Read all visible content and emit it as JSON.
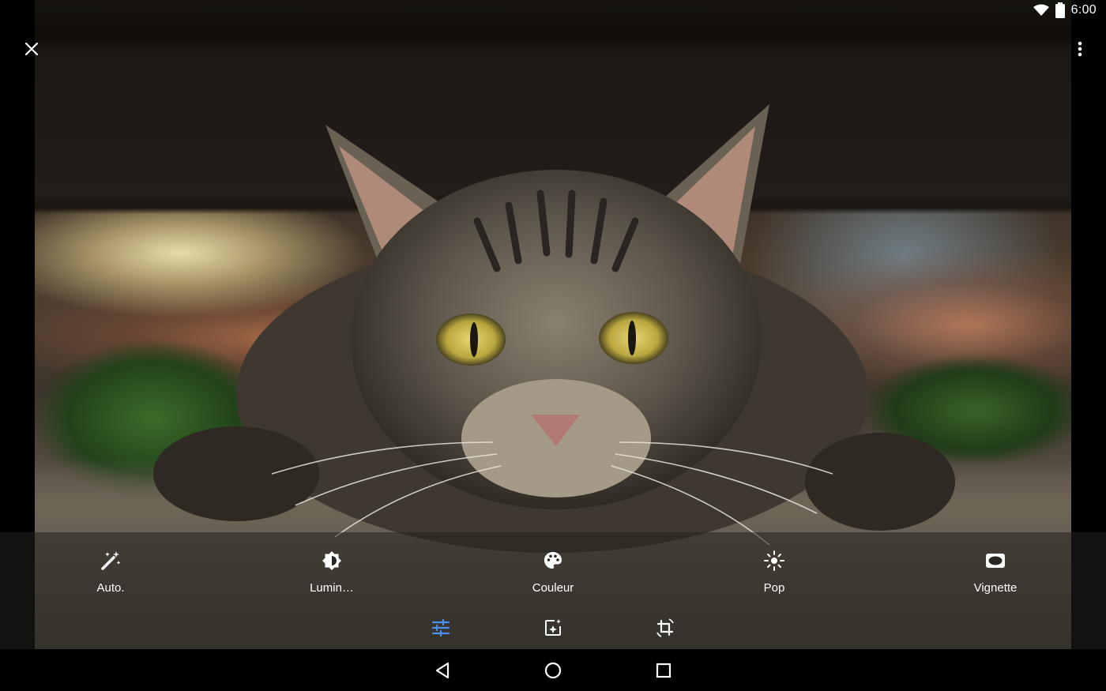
{
  "status_bar": {
    "time": "6:00",
    "icons": [
      "wifi-icon",
      "battery-icon"
    ]
  },
  "top_bar": {
    "close_icon": "close-icon",
    "menu_icon": "more-vert-icon"
  },
  "photo": {
    "subject": "tabby cat photo"
  },
  "edit_tools": [
    {
      "label": "Auto.",
      "icon": "magic-wand-icon"
    },
    {
      "label": "Lumin…",
      "icon": "brightness-icon"
    },
    {
      "label": "Couleur",
      "icon": "palette-icon"
    },
    {
      "label": "Pop",
      "icon": "pop-icon"
    },
    {
      "label": "Vignette",
      "icon": "vignette-icon"
    }
  ],
  "mode_tabs": [
    {
      "icon": "tune-icon",
      "active": true
    },
    {
      "icon": "filters-icon",
      "active": false
    },
    {
      "icon": "crop-rotate-icon",
      "active": false
    }
  ],
  "nav_bar": [
    "back-icon",
    "home-icon",
    "recents-icon"
  ],
  "colors": {
    "accent": "#4a90f2",
    "icon": "#ffffff",
    "panel": "#2a2723"
  }
}
